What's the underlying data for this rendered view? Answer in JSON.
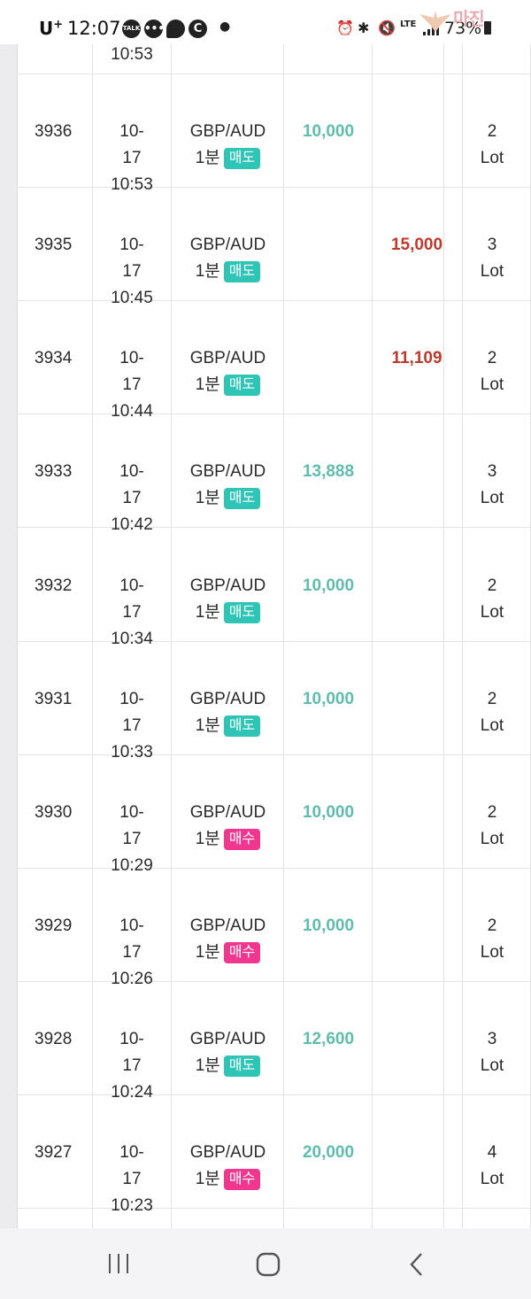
{
  "status_bar": {
    "carrier": "U",
    "carrier_plus": "+",
    "time": "12:07",
    "notif_icons": [
      "talk-icon",
      "chat-icon",
      "message-icon",
      "c-icon"
    ],
    "talk_label": "TALK",
    "c_label": "C",
    "lte": "LTE",
    "battery": "73%",
    "watermark": "마진"
  },
  "columns": {
    "divider_after": [
      "id",
      "date",
      "symbol",
      "profit",
      "loss",
      "lot"
    ]
  },
  "rows": [
    {
      "id": "",
      "date": [
        "",
        "",
        "10:53"
      ],
      "symbol": "",
      "period": "",
      "side": "",
      "profit": "",
      "loss": "",
      "lot": [
        "",
        ""
      ]
    },
    {
      "id": "3936",
      "date": [
        "10-",
        "17",
        "10:53"
      ],
      "symbol": "GBP/AUD",
      "period": "1분",
      "side": "매도",
      "side_type": "sell",
      "profit": "10,000",
      "loss": "",
      "lot": [
        "2",
        "Lot"
      ]
    },
    {
      "id": "3935",
      "date": [
        "10-",
        "17",
        "10:45"
      ],
      "symbol": "GBP/AUD",
      "period": "1분",
      "side": "매도",
      "side_type": "sell",
      "profit": "",
      "loss": "15,000",
      "lot": [
        "3",
        "Lot"
      ]
    },
    {
      "id": "3934",
      "date": [
        "10-",
        "17",
        "10:44"
      ],
      "symbol": "GBP/AUD",
      "period": "1분",
      "side": "매도",
      "side_type": "sell",
      "profit": "",
      "loss": "11,109",
      "lot": [
        "2",
        "Lot"
      ]
    },
    {
      "id": "3933",
      "date": [
        "10-",
        "17",
        "10:42"
      ],
      "symbol": "GBP/AUD",
      "period": "1분",
      "side": "매도",
      "side_type": "sell",
      "profit": "13,888",
      "loss": "",
      "lot": [
        "3",
        "Lot"
      ]
    },
    {
      "id": "3932",
      "date": [
        "10-",
        "17",
        "10:34"
      ],
      "symbol": "GBP/AUD",
      "period": "1분",
      "side": "매도",
      "side_type": "sell",
      "profit": "10,000",
      "loss": "",
      "lot": [
        "2",
        "Lot"
      ]
    },
    {
      "id": "3931",
      "date": [
        "10-",
        "17",
        "10:33"
      ],
      "symbol": "GBP/AUD",
      "period": "1분",
      "side": "매도",
      "side_type": "sell",
      "profit": "10,000",
      "loss": "",
      "lot": [
        "2",
        "Lot"
      ]
    },
    {
      "id": "3930",
      "date": [
        "10-",
        "17",
        "10:29"
      ],
      "symbol": "GBP/AUD",
      "period": "1분",
      "side": "매수",
      "side_type": "buy",
      "profit": "10,000",
      "loss": "",
      "lot": [
        "2",
        "Lot"
      ]
    },
    {
      "id": "3929",
      "date": [
        "10-",
        "17",
        "10:26"
      ],
      "symbol": "GBP/AUD",
      "period": "1분",
      "side": "매수",
      "side_type": "buy",
      "profit": "10,000",
      "loss": "",
      "lot": [
        "2",
        "Lot"
      ]
    },
    {
      "id": "3928",
      "date": [
        "10-",
        "17",
        "10:24"
      ],
      "symbol": "GBP/AUD",
      "period": "1분",
      "side": "매도",
      "side_type": "sell",
      "profit": "12,600",
      "loss": "",
      "lot": [
        "3",
        "Lot"
      ]
    },
    {
      "id": "3927",
      "date": [
        "10-",
        "17",
        "10:23"
      ],
      "symbol": "GBP/AUD",
      "period": "1분",
      "side": "매수",
      "side_type": "buy",
      "profit": "20,000",
      "loss": "",
      "lot": [
        "4",
        "Lot"
      ]
    }
  ],
  "colors": {
    "profit": "#5ebdae",
    "loss": "#c0392b",
    "sell_badge": "#2ec4b6",
    "buy_badge": "#f0368e"
  },
  "nav_bar": {
    "buttons": [
      "recent-apps-icon",
      "home-icon",
      "back-icon"
    ]
  }
}
